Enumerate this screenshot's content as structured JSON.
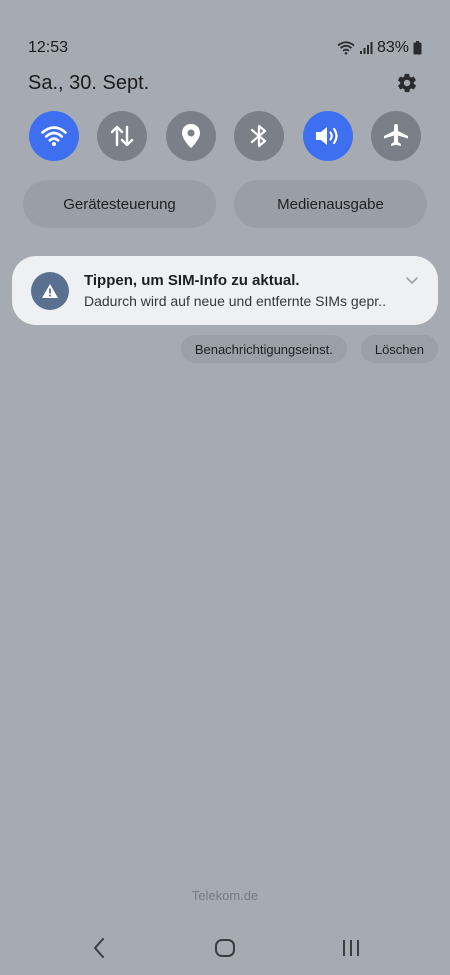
{
  "status_bar": {
    "time": "12:53",
    "battery": "83%",
    "icons": [
      "wifi-icon",
      "signal-icon",
      "battery-icon"
    ]
  },
  "header": {
    "date": "Sa., 30. Sept.",
    "settings_icon": "gear-icon"
  },
  "quick_toggles": [
    {
      "name": "wifi",
      "icon": "wifi-icon",
      "state": "on"
    },
    {
      "name": "mobile-data",
      "icon": "data-arrows-icon",
      "state": "off"
    },
    {
      "name": "location",
      "icon": "location-pin-icon",
      "state": "off"
    },
    {
      "name": "bluetooth",
      "icon": "bluetooth-icon",
      "state": "off"
    },
    {
      "name": "sound",
      "icon": "volume-icon",
      "state": "on"
    },
    {
      "name": "airplane",
      "icon": "airplane-icon",
      "state": "off"
    }
  ],
  "pills": {
    "device_control": "Gerätesteuerung",
    "media_output": "Medienausgabe"
  },
  "notification": {
    "icon": "warning-icon",
    "title": "Tippen, um SIM-Info zu aktual.",
    "text": "Dadurch wird auf neue und entfernte SIMs gepr.."
  },
  "actions": {
    "settings": "Benachrichtigungseinst.",
    "clear": "Löschen"
  },
  "carrier": "Telekom.de",
  "nav": {
    "back": "back-icon",
    "home": "home-icon",
    "recents": "recents-icon"
  },
  "colors": {
    "background": "#a6abb3",
    "accent": "#3f6ff1",
    "toggle_off": "#7b8088",
    "card": "#eef0f3"
  }
}
